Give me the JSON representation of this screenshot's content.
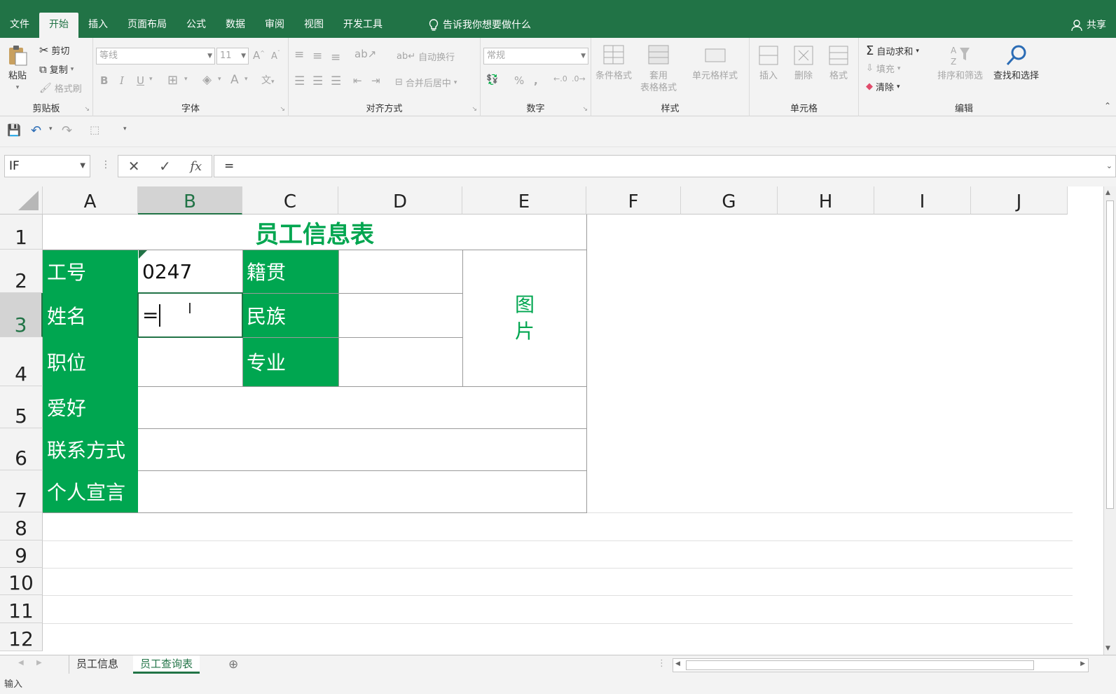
{
  "ribbon_tabs": [
    "文件",
    "开始",
    "插入",
    "页面布局",
    "公式",
    "数据",
    "审阅",
    "视图",
    "开发工具"
  ],
  "active_tab": "开始",
  "tell_me": "告诉我你想要做什么",
  "share": "共享",
  "clipboard": {
    "paste": "粘贴",
    "cut": "剪切",
    "copy": "复制",
    "format_painter": "格式刷",
    "label": "剪贴板"
  },
  "font": {
    "name": "等线",
    "size": "11",
    "label": "字体",
    "bold": "B",
    "italic": "I",
    "underline": "U",
    "grow": "A",
    "shrink": "A",
    "color": "A",
    "phonetic": "文"
  },
  "alignment": {
    "wrap": "自动换行",
    "merge": "合并后居中",
    "label": "对齐方式"
  },
  "number": {
    "format": "常规",
    "label": "数字",
    "percent": "%",
    "comma": ","
  },
  "styles": {
    "conditional": "条件格式",
    "table_1": "套用",
    "table_2": "表格格式",
    "cell_styles": "单元格样式",
    "label": "样式"
  },
  "cells": {
    "insert": "插入",
    "delete": "删除",
    "format": "格式",
    "label": "单元格"
  },
  "editing": {
    "autosum": "自动求和",
    "fill": "填充",
    "clear": "清除",
    "sort": "排序和筛选",
    "find": "查找和选择",
    "label": "编辑"
  },
  "formula_bar": {
    "name_box": "IF",
    "content": "="
  },
  "columns": [
    "A",
    "B",
    "C",
    "D",
    "E",
    "F",
    "G",
    "H",
    "I",
    "J"
  ],
  "rows": [
    "1",
    "2",
    "3",
    "4",
    "5",
    "6",
    "7",
    "8",
    "9",
    "10",
    "11",
    "12"
  ],
  "sheet": {
    "title": "员工信息表",
    "a2": "工号",
    "b2": "0247",
    "c2": "籍贯",
    "a3": "姓名",
    "b3": "=",
    "c3": "民族",
    "a4": "职位",
    "c4": "专业",
    "a5": "爱好",
    "a6": "联系方式",
    "a7": "个人宣言",
    "picture": "图\n片"
  },
  "sheet_tabs": [
    "员工信息",
    "员工查询表"
  ],
  "active_sheet": "员工查询表",
  "status": "输入",
  "colors": {
    "excel_green": "#217346",
    "cell_green": "#00a650"
  }
}
